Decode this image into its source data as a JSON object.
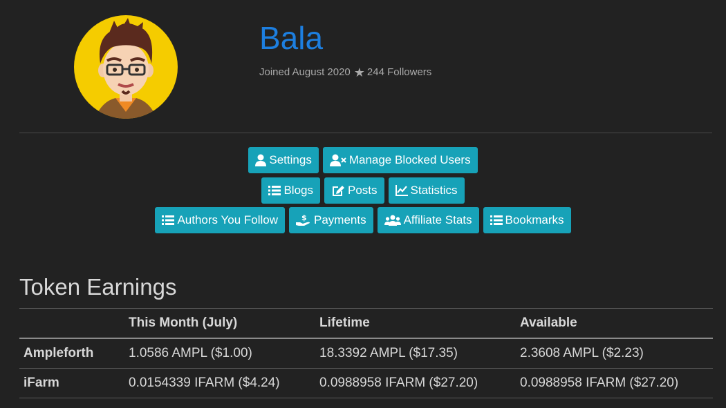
{
  "profile": {
    "name": "Bala",
    "joined": "Joined August 2020",
    "followers": "244 Followers"
  },
  "buttons": {
    "settings": "Settings",
    "manage_blocked": "Manage Blocked Users",
    "blogs": "Blogs",
    "posts": "Posts",
    "statistics": "Statistics",
    "authors_follow": "Authors You Follow",
    "payments": "Payments",
    "affiliate_stats": "Affiliate Stats",
    "bookmarks": "Bookmarks"
  },
  "earnings": {
    "title": "Token Earnings",
    "headers": [
      "",
      "This Month (July)",
      "Lifetime",
      "Available"
    ],
    "rows": [
      {
        "token": "Ampleforth",
        "month": "1.0586 AMPL ($1.00)",
        "lifetime": "18.3392 AMPL ($17.35)",
        "available": "2.3608 AMPL ($2.23)"
      },
      {
        "token": "iFarm",
        "month": "0.0154339 IFARM ($4.24)",
        "lifetime": "0.0988958 IFARM ($27.20)",
        "available": "0.0988958 IFARM ($27.20)"
      }
    ]
  },
  "colors": {
    "background": "#222222",
    "accent_button": "#17a2b8",
    "username": "#1d7fe0",
    "avatar_bg": "#f5cc00"
  },
  "icons": [
    "star-icon",
    "user-icon",
    "user-block-icon",
    "list-icon",
    "edit-icon",
    "chart-line-icon",
    "hand-dollar-icon",
    "users-icon"
  ]
}
